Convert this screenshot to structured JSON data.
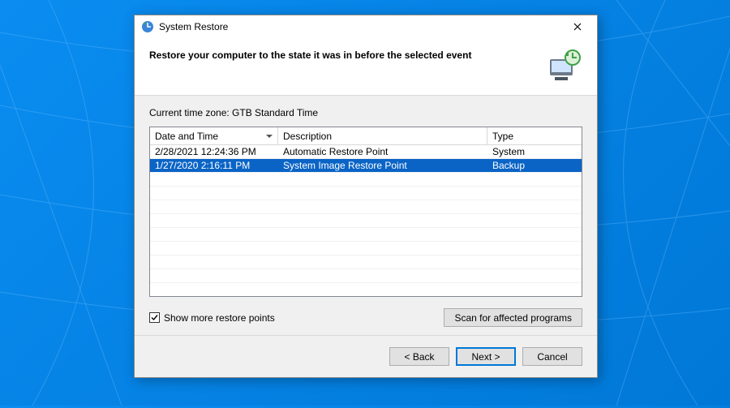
{
  "window": {
    "title": "System Restore"
  },
  "header": {
    "heading": "Restore your computer to the state it was in before the selected event"
  },
  "timezone_label": "Current time zone: GTB Standard Time",
  "table": {
    "columns": {
      "date": "Date and Time",
      "description": "Description",
      "type": "Type"
    },
    "rows": [
      {
        "date": "2/28/2021 12:24:36 PM",
        "description": "Automatic Restore Point",
        "type": "System",
        "selected": false
      },
      {
        "date": "1/27/2020 2:16:11 PM",
        "description": "System Image Restore Point",
        "type": "Backup",
        "selected": true
      }
    ]
  },
  "checkbox": {
    "label": "Show more restore points",
    "checked": true
  },
  "buttons": {
    "scan": "Scan for affected programs",
    "back": "< Back",
    "next": "Next >",
    "cancel": "Cancel"
  }
}
